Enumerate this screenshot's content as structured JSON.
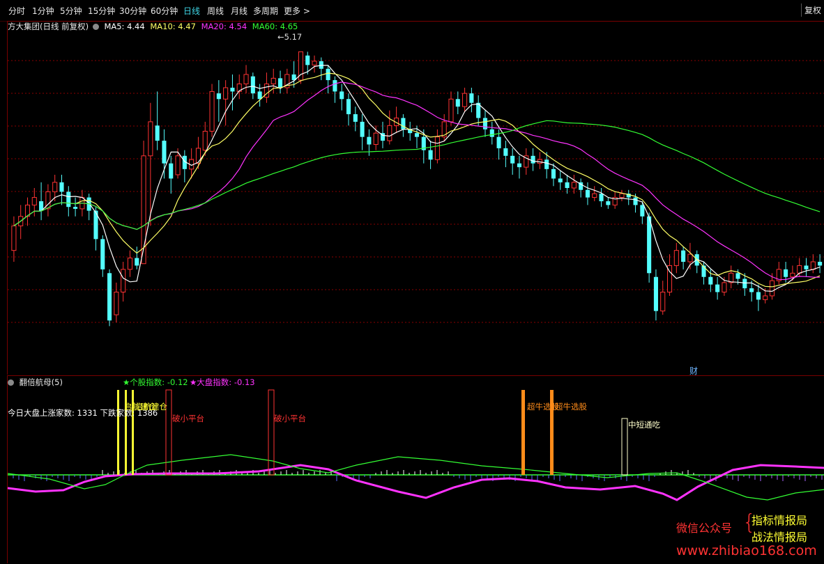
{
  "toolbar": {
    "periods": [
      "分时",
      "1分钟",
      "5分钟",
      "15分钟",
      "30分钟",
      "60分钟",
      "日线",
      "周线",
      "月线",
      "多周期",
      "更多 >"
    ],
    "active_index": 6,
    "right_label": "复权"
  },
  "main_info": {
    "title": "方大集团(日线 前复权)",
    "ma5": "MA5: 4.44",
    "ma10": "MA10: 4.47",
    "ma20": "MA20: 4.54",
    "ma60": "MA60: 4.65",
    "high_label": "5.17",
    "finance_marker": "财"
  },
  "sub_info": {
    "title": "翻倍航母(5)",
    "stock_index": "★个股指数: -0.12",
    "market_index": "★大盘指数: -0.13",
    "breadth": "今日大盘上涨家数: 1331 下跌家数: 1386",
    "signals": {
      "break_platform": "破小平台",
      "super_bull": "超牛选股",
      "short_term": "中短通吃",
      "overlap": "启航建仓"
    }
  },
  "watermark": {
    "wechat": "微信公众号",
    "line1": "指标情报局",
    "line2": "战法情报局",
    "url": "www.zhibiao168.com"
  },
  "colors": {
    "up": "#ff3333",
    "down": "#54ffff",
    "ma5": "#ffffff",
    "ma10": "#ffff66",
    "ma20": "#ff33ff",
    "ma60": "#33ff33",
    "grid": "#8b0000"
  },
  "chart_data": {
    "type": "candlestick",
    "candles": [
      [
        4.12,
        4.25,
        4.06,
        4.3
      ],
      [
        4.25,
        4.3,
        4.18,
        4.36
      ],
      [
        4.3,
        4.36,
        4.25,
        4.4
      ],
      [
        4.36,
        4.4,
        4.3,
        4.45
      ],
      [
        4.38,
        4.33,
        4.28,
        4.48
      ],
      [
        4.34,
        4.43,
        4.3,
        4.47
      ],
      [
        4.43,
        4.48,
        4.38,
        4.52
      ],
      [
        4.48,
        4.43,
        4.36,
        4.52
      ],
      [
        4.43,
        4.35,
        4.3,
        4.46
      ],
      [
        4.35,
        4.34,
        4.3,
        4.4
      ],
      [
        4.34,
        4.4,
        4.3,
        4.44
      ],
      [
        4.4,
        4.33,
        4.28,
        4.42
      ],
      [
        4.33,
        4.18,
        4.12,
        4.35
      ],
      [
        4.18,
        4.02,
        3.98,
        4.2
      ],
      [
        4.0,
        3.75,
        3.72,
        4.02
      ],
      [
        3.78,
        3.9,
        3.74,
        3.95
      ],
      [
        3.9,
        4.02,
        3.85,
        4.06
      ],
      [
        4.02,
        4.08,
        3.98,
        4.12
      ],
      [
        4.08,
        4.04,
        4.02,
        4.14
      ],
      [
        4.05,
        4.62,
        4.05,
        4.7
      ],
      [
        4.62,
        4.8,
        4.25,
        4.9
      ],
      [
        4.78,
        4.7,
        4.65,
        4.96
      ],
      [
        4.7,
        4.58,
        4.5,
        4.76
      ],
      [
        4.58,
        4.5,
        4.42,
        4.62
      ],
      [
        4.52,
        4.62,
        4.5,
        4.66
      ],
      [
        4.62,
        4.55,
        4.48,
        4.65
      ],
      [
        4.55,
        4.6,
        4.5,
        4.66
      ],
      [
        4.58,
        4.66,
        4.55,
        4.72
      ],
      [
        4.65,
        4.75,
        4.62,
        4.8
      ],
      [
        4.75,
        4.96,
        4.72,
        5.0
      ],
      [
        4.95,
        4.92,
        4.8,
        5.02
      ],
      [
        4.92,
        4.98,
        4.78,
        5.02
      ],
      [
        4.98,
        4.96,
        4.86,
        5.05
      ],
      [
        4.96,
        5.0,
        4.92,
        5.05
      ],
      [
        5.0,
        5.05,
        4.95,
        5.1
      ],
      [
        5.04,
        4.95,
        4.92,
        5.06
      ],
      [
        4.96,
        4.92,
        4.88,
        5.0
      ],
      [
        4.93,
        5.0,
        4.9,
        5.06
      ],
      [
        5.0,
        5.03,
        4.95,
        5.08
      ],
      [
        5.03,
        4.98,
        4.95,
        5.07
      ],
      [
        4.98,
        5.05,
        4.95,
        5.08
      ],
      [
        5.05,
        5.02,
        4.98,
        5.12
      ],
      [
        5.02,
        5.17,
        5.0,
        5.17
      ],
      [
        5.15,
        5.1,
        5.05,
        5.17
      ],
      [
        5.1,
        5.12,
        5.06,
        5.15
      ],
      [
        5.12,
        5.08,
        5.02,
        5.14
      ],
      [
        5.08,
        5.02,
        4.95,
        5.1
      ],
      [
        5.02,
        4.96,
        4.9,
        5.04
      ],
      [
        4.96,
        4.92,
        4.86,
        5.0
      ],
      [
        4.92,
        4.84,
        4.78,
        4.95
      ],
      [
        4.84,
        4.8,
        4.75,
        4.88
      ],
      [
        4.8,
        4.72,
        4.65,
        4.84
      ],
      [
        4.72,
        4.68,
        4.62,
        4.76
      ],
      [
        4.68,
        4.74,
        4.65,
        4.78
      ],
      [
        4.74,
        4.7,
        4.66,
        4.8
      ],
      [
        4.7,
        4.78,
        4.68,
        4.86
      ],
      [
        4.78,
        4.82,
        4.74,
        4.88
      ],
      [
        4.82,
        4.76,
        4.72,
        4.84
      ],
      [
        4.76,
        4.74,
        4.7,
        4.8
      ],
      [
        4.74,
        4.72,
        4.66,
        4.78
      ],
      [
        4.72,
        4.65,
        4.58,
        4.76
      ],
      [
        4.65,
        4.6,
        4.55,
        4.7
      ],
      [
        4.6,
        4.72,
        4.58,
        4.76
      ],
      [
        4.72,
        4.8,
        4.7,
        4.84
      ],
      [
        4.8,
        4.92,
        4.78,
        4.96
      ],
      [
        4.92,
        4.88,
        4.84,
        4.96
      ],
      [
        4.88,
        4.95,
        4.85,
        4.98
      ],
      [
        4.95,
        4.9,
        4.85,
        4.98
      ],
      [
        4.9,
        4.82,
        4.78,
        4.94
      ],
      [
        4.82,
        4.76,
        4.72,
        4.86
      ],
      [
        4.76,
        4.72,
        4.68,
        4.8
      ],
      [
        4.72,
        4.66,
        4.6,
        4.76
      ],
      [
        4.66,
        4.62,
        4.56,
        4.7
      ],
      [
        4.62,
        4.58,
        4.52,
        4.66
      ],
      [
        4.58,
        4.56,
        4.5,
        4.62
      ],
      [
        4.56,
        4.62,
        4.52,
        4.66
      ],
      [
        4.62,
        4.58,
        4.54,
        4.66
      ],
      [
        4.58,
        4.6,
        4.55,
        4.64
      ],
      [
        4.6,
        4.55,
        4.5,
        4.64
      ],
      [
        4.55,
        4.5,
        4.46,
        4.58
      ],
      [
        4.5,
        4.48,
        4.44,
        4.54
      ],
      [
        4.48,
        4.45,
        4.42,
        4.52
      ],
      [
        4.45,
        4.48,
        4.42,
        4.52
      ],
      [
        4.48,
        4.44,
        4.4,
        4.5
      ],
      [
        4.44,
        4.4,
        4.36,
        4.48
      ],
      [
        4.4,
        4.42,
        4.38,
        4.46
      ],
      [
        4.42,
        4.38,
        4.35,
        4.45
      ],
      [
        4.38,
        4.36,
        4.34,
        4.4
      ],
      [
        4.36,
        4.4,
        4.34,
        4.43
      ],
      [
        4.4,
        4.42,
        4.38,
        4.44
      ],
      [
        4.42,
        4.4,
        4.36,
        4.44
      ],
      [
        4.4,
        4.36,
        4.32,
        4.42
      ],
      [
        4.36,
        4.3,
        4.26,
        4.38
      ],
      [
        4.3,
        4.0,
        3.95,
        4.32
      ],
      [
        3.98,
        3.8,
        3.75,
        4.02
      ],
      [
        3.8,
        3.9,
        3.78,
        3.96
      ],
      [
        3.9,
        4.04,
        3.88,
        4.1
      ],
      [
        4.04,
        4.12,
        4.0,
        4.16
      ],
      [
        4.12,
        4.06,
        4.02,
        4.14
      ],
      [
        4.06,
        4.1,
        4.02,
        4.16
      ],
      [
        4.1,
        4.04,
        4.0,
        4.12
      ],
      [
        4.04,
        3.98,
        3.94,
        4.06
      ],
      [
        3.98,
        3.94,
        3.9,
        4.02
      ],
      [
        3.94,
        3.9,
        3.86,
        3.98
      ],
      [
        3.9,
        3.95,
        3.88,
        3.98
      ],
      [
        3.95,
        4.0,
        3.92,
        4.04
      ],
      [
        4.0,
        3.97,
        3.94,
        4.02
      ],
      [
        3.97,
        3.92,
        3.88,
        4.0
      ],
      [
        3.92,
        3.9,
        3.85,
        3.96
      ],
      [
        3.9,
        3.86,
        3.8,
        3.94
      ],
      [
        3.86,
        3.88,
        3.84,
        3.92
      ],
      [
        3.88,
        3.96,
        3.86,
        4.0
      ],
      [
        3.96,
        4.02,
        3.94,
        4.06
      ],
      [
        4.02,
        3.98,
        3.95,
        4.06
      ],
      [
        3.98,
        4.0,
        3.96,
        4.04
      ],
      [
        4.0,
        4.04,
        3.98,
        4.08
      ],
      [
        4.04,
        4.02,
        3.98,
        4.08
      ],
      [
        4.02,
        4.06,
        4.0,
        4.1
      ],
      [
        4.06,
        4.04,
        4.0,
        4.1
      ]
    ],
    "ylim": [
      3.6,
      5.3
    ],
    "high_annotation": 5.17,
    "oscillator": {
      "series": [
        {
          "name": "★个股指数",
          "last": -0.12
        },
        {
          "name": "★大盘指数",
          "last": -0.13
        }
      ]
    }
  }
}
